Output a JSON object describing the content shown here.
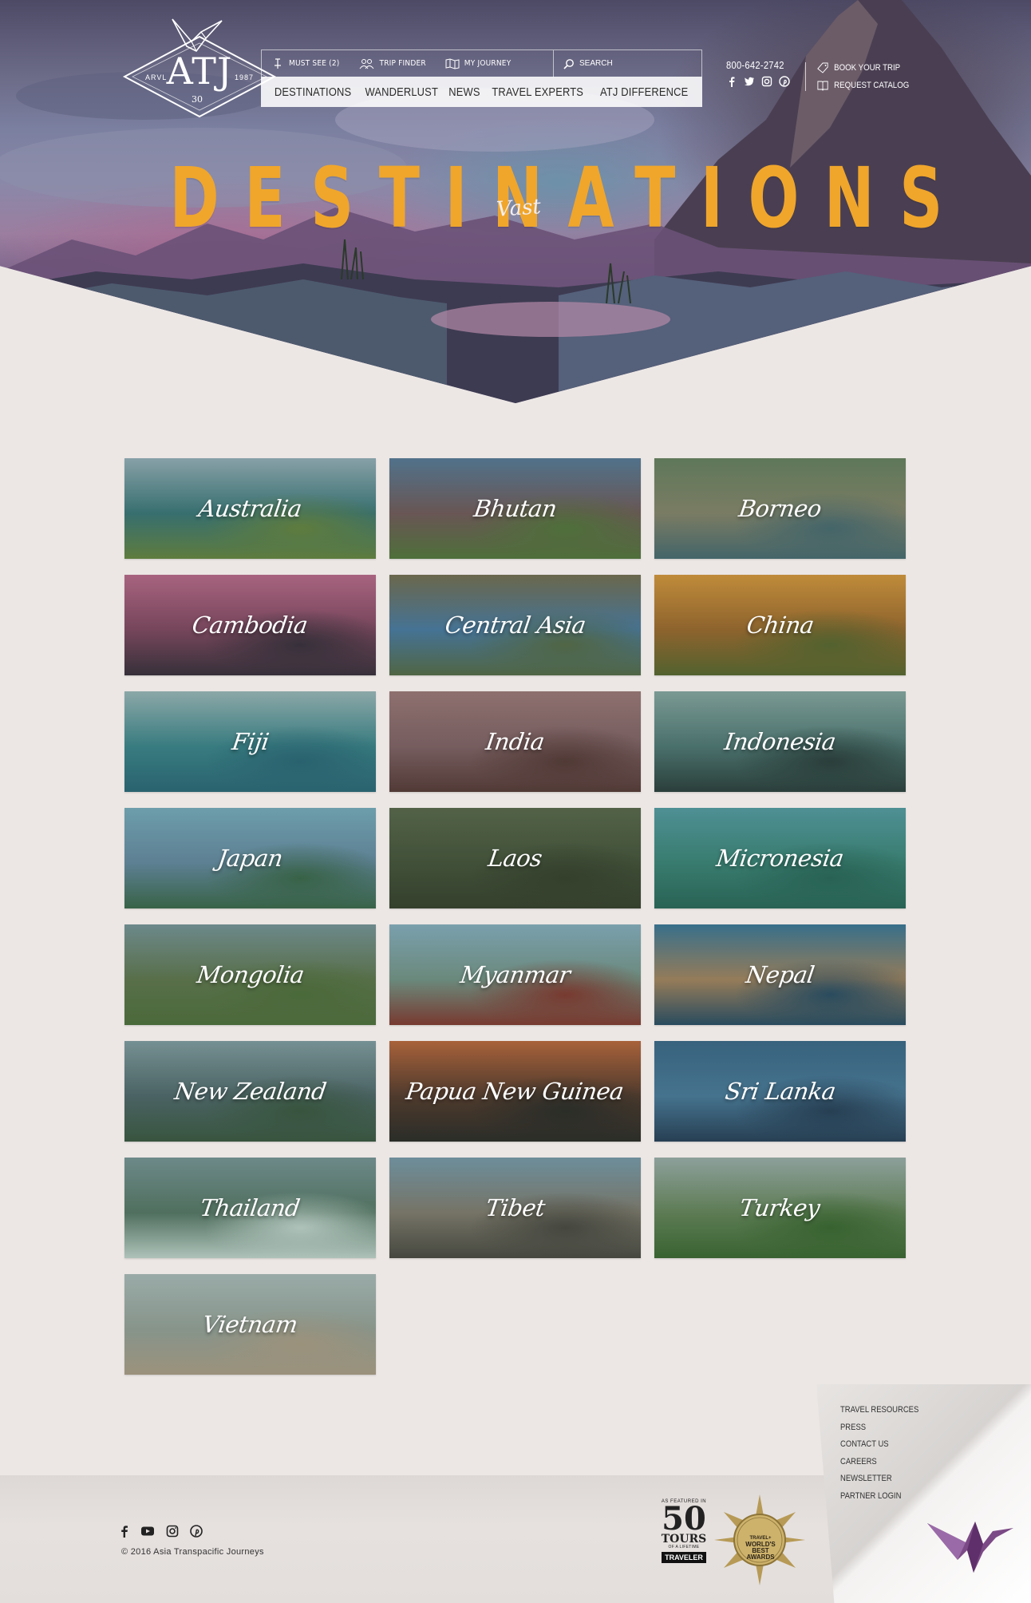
{
  "header": {
    "logo": {
      "text": "ATJ",
      "left_small": "ARVL",
      "right_small": "1987",
      "badge": "30"
    },
    "utility_nav": [
      {
        "label": "MUST SEE (2)",
        "icon": "pin-icon"
      },
      {
        "label": "TRIP FINDER",
        "icon": "people-icon"
      },
      {
        "label": "MY JOURNEY",
        "icon": "map-icon"
      }
    ],
    "search_label": "SEARCH",
    "main_nav": [
      "DESTINATIONS",
      "WANDERLUST",
      "NEWS",
      "TRAVEL EXPERTS",
      "ATJ DIFFERENCE"
    ],
    "phone": "800-642-2742",
    "social_icons": [
      "facebook-icon",
      "twitter-icon",
      "instagram-icon",
      "pinterest-icon"
    ],
    "cta": [
      {
        "label": "BOOK YOUR TRIP",
        "icon": "tag-icon"
      },
      {
        "label": "REQUEST CATALOG",
        "icon": "book-icon"
      }
    ]
  },
  "hero": {
    "title": "DESTINATIONS",
    "subtitle": "Vast"
  },
  "destinations": [
    {
      "name": "Australia",
      "colors": [
        "#9fb7c0",
        "#3e7a7a",
        "#6d8a3f"
      ]
    },
    {
      "name": "Bhutan",
      "colors": [
        "#5d7e9c",
        "#7a5c5a",
        "#5a7a3a"
      ]
    },
    {
      "name": "Borneo",
      "colors": [
        "#6e8660",
        "#8f8a6c",
        "#4d6e73"
      ]
    },
    {
      "name": "Cambodia",
      "colors": [
        "#c76c8e",
        "#8a4862",
        "#3d2e3a"
      ]
    },
    {
      "name": "Central Asia",
      "colors": [
        "#7c7150",
        "#4f7fa8",
        "#5c6f46"
      ]
    },
    {
      "name": "China",
      "colors": [
        "#e49d3a",
        "#a76c2a",
        "#5f6b2c"
      ]
    },
    {
      "name": "Fiji",
      "colors": [
        "#a5bfbf",
        "#3f8a8f",
        "#2d6b7a"
      ]
    },
    {
      "name": "India",
      "colors": [
        "#a77c7a",
        "#8a6466",
        "#5d3a35"
      ]
    },
    {
      "name": "Indonesia",
      "colors": [
        "#8faea6",
        "#557c77",
        "#2e3f3a"
      ]
    },
    {
      "name": "Japan",
      "colors": [
        "#7fb3c4",
        "#6c8fa6",
        "#3f6b4a"
      ]
    },
    {
      "name": "Laos",
      "colors": [
        "#5f6b4a",
        "#4a5538",
        "#3a4029"
      ]
    },
    {
      "name": "Micronesia",
      "colors": [
        "#5aa3a8",
        "#3f8a7a",
        "#2c6b5a"
      ]
    },
    {
      "name": "Mongolia",
      "colors": [
        "#7f9a9c",
        "#667a4d",
        "#55743a"
      ]
    },
    {
      "name": "Myanmar",
      "colors": [
        "#8fb6c6",
        "#7c9a8a",
        "#8c3a2e"
      ]
    },
    {
      "name": "Nepal",
      "colors": [
        "#3f7b9c",
        "#b08a60",
        "#2d4f66"
      ]
    },
    {
      "name": "New Zealand",
      "colors": [
        "#8aa3a6",
        "#556b6c",
        "#3f5a3f"
      ]
    },
    {
      "name": "Papua New Guinea",
      "colors": [
        "#c76a3a",
        "#5a3a2a",
        "#2e2a24"
      ]
    },
    {
      "name": "Sri Lanka",
      "colors": [
        "#3f6b8c",
        "#4f7fa0",
        "#2a4058"
      ]
    },
    {
      "name": "Thailand",
      "colors": [
        "#7f9a9a",
        "#5c7b66",
        "#cfe0d6"
      ]
    },
    {
      "name": "Tibet",
      "colors": [
        "#7fa0b0",
        "#8a8070",
        "#4f4a40"
      ]
    },
    {
      "name": "Turkey",
      "colors": [
        "#a6b6b0",
        "#6c8a5a",
        "#3f6b2e"
      ]
    },
    {
      "name": "Vietnam",
      "colors": [
        "#b6c4c0",
        "#9fa89c",
        "#b8a58a"
      ]
    }
  ],
  "footer": {
    "links": [
      "TRAVEL RESOURCES",
      "PRESS",
      "CONTACT US",
      "CAREERS",
      "NEWSLETTER",
      "PARTNER LOGIN"
    ],
    "social_icons": [
      "facebook-icon",
      "youtube-icon",
      "instagram-icon",
      "pinterest-icon"
    ],
    "copyright": "© 2016 Asia Transpacific Journeys",
    "badge_50": {
      "top": "AS FEATURED IN",
      "number": "50",
      "line1": "TOURS",
      "line2": "OF A LIFETIME",
      "brand": "TRAVELER"
    },
    "award": {
      "line1": "TRAVEL+",
      "line2": "WORLD'S",
      "line3": "BEST",
      "line4": "AWARDS"
    }
  }
}
